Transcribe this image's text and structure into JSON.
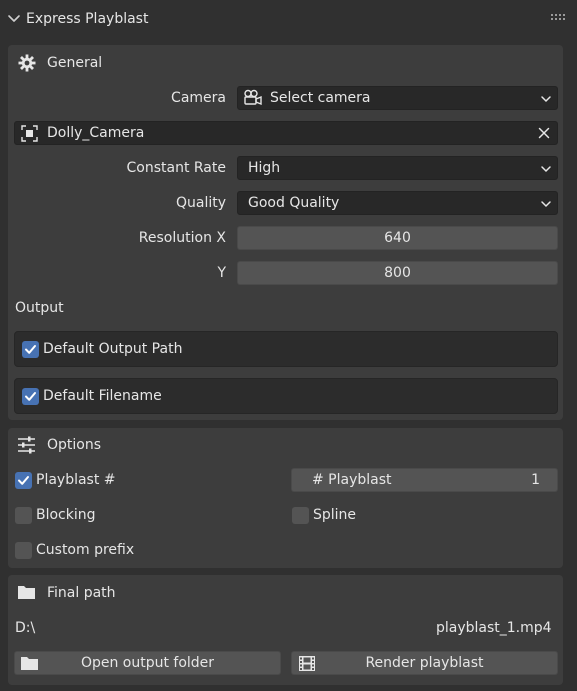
{
  "panel": {
    "title": "Express Playblast"
  },
  "general": {
    "title": "General",
    "camera_label": "Camera",
    "camera_value": "Select camera",
    "selected_camera": "Dolly_Camera",
    "constant_rate_label": "Constant Rate",
    "constant_rate_value": "High",
    "quality_label": "Quality",
    "quality_value": "Good Quality",
    "resolution_x_label": "Resolution X",
    "resolution_x_value": "640",
    "resolution_y_label": "Y",
    "resolution_y_value": "800",
    "output_label": "Output",
    "default_output_path_label": "Default Output Path",
    "default_output_path_checked": true,
    "default_filename_label": "Default Filename",
    "default_filename_checked": true
  },
  "options": {
    "title": "Options",
    "playblast_num_label": "Playblast #",
    "playblast_num_checked": true,
    "playblast_counter_label": "# Playblast",
    "playblast_counter_value": "1",
    "blocking_label": "Blocking",
    "blocking_checked": false,
    "spline_label": "Spline",
    "spline_checked": false,
    "custom_prefix_label": "Custom prefix",
    "custom_prefix_checked": false
  },
  "final_path": {
    "title": "Final path",
    "drive": "D:\\",
    "filename": "playblast_1.mp4",
    "open_folder_label": "Open output folder",
    "render_label": "Render playblast"
  },
  "colors": {
    "background": "#303030",
    "subpanel": "#3d3d3d",
    "field_dark": "#282828",
    "field_numeric": "#545454",
    "checkbox_on": "#4772b3",
    "text": "#e6e6e6"
  }
}
